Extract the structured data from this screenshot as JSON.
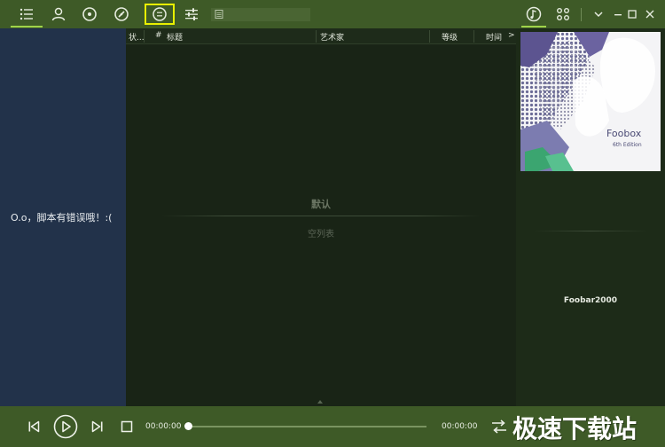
{
  "toolbar": {
    "icons": [
      "list-icon",
      "user-icon",
      "disc-icon",
      "gauge-icon",
      "menu-circle-icon",
      "sliders-icon"
    ],
    "right_icons": [
      "music-note-icon",
      "grid-icon"
    ],
    "window_controls": [
      "chevron-down-icon",
      "minimize-icon",
      "maximize-icon",
      "close-icon"
    ]
  },
  "left_panel": {
    "error_message": "O.o，脚本有错误哦！:("
  },
  "playlist": {
    "columns": [
      "状...",
      "#",
      "标题",
      "艺术家",
      "等级",
      "时间"
    ],
    "more_indicator": ">",
    "name": "默认",
    "empty_text": "空列表"
  },
  "right_panel": {
    "cover_title": "Foobox",
    "cover_subtitle": "6th Edition",
    "label": "Foobar2000"
  },
  "transport": {
    "current_time": "00:00:00",
    "total_time": "00:00:00",
    "progress": 0
  },
  "watermark": "极速下载站",
  "colors": {
    "toolbar_bg": "#3e5a27",
    "accent": "#9fd34a",
    "left_panel_bg": "#22324a",
    "playlist_bg": "#192416",
    "highlight": "#e8f000"
  }
}
